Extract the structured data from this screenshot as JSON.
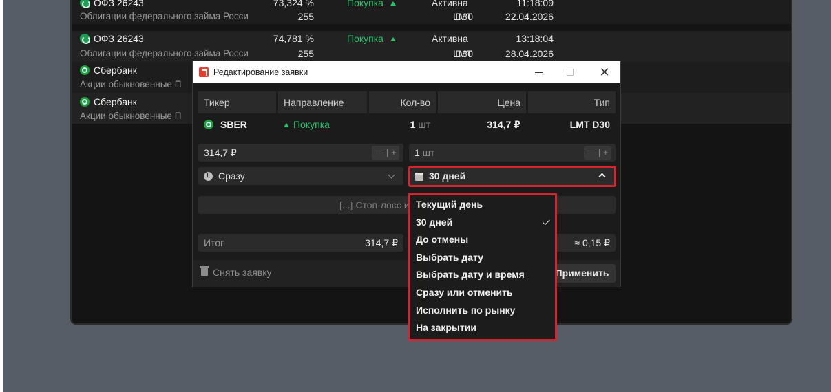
{
  "background_rows": [
    {
      "name": "ОФЗ 26243",
      "subtitle": "Облигации федерального займа Росси",
      "price": "73,324 %",
      "qty": "255",
      "direction": "Покупка",
      "type": "LMT",
      "status": "Активна",
      "duration": "D30",
      "time": "11:18:09",
      "date": "22.04.2026",
      "icon": "ofz-icon"
    },
    {
      "name": "ОФЗ 26243",
      "subtitle": "Облигации федерального займа Росси",
      "price": "74,781 %",
      "qty": "255",
      "direction": "Покупка",
      "type": "LMT",
      "status": "Активна",
      "duration": "D30",
      "time": "13:18:04",
      "date": "28.04.2026",
      "icon": "ofz-icon"
    },
    {
      "name": "Сбербанк",
      "subtitle": "Акции обыкновенные П",
      "icon": "sber-icon"
    },
    {
      "name": "Сбербанк",
      "subtitle": "Акции обыкновенные П",
      "icon": "sber-icon"
    }
  ],
  "dialog": {
    "title": "Редактирование заявки",
    "columns": [
      "Тикер",
      "Направление",
      "Кол-во",
      "Цена",
      "Тип"
    ],
    "order": {
      "ticker": "SBER",
      "direction": "Покупка",
      "qty": "1",
      "qty_unit": "шт",
      "price": "314,7 ₽",
      "type": "LMT D30"
    },
    "price_field": "314,7 ₽",
    "qty_field_value": "1",
    "qty_field_unit": "шт",
    "stepper": "— | +",
    "execution_select": "Сразу",
    "duration_select": "30 дней",
    "stop_loss_placeholder": "[...] Стоп-лосс и",
    "total_label": "Итог",
    "total_value": "314,7 ₽",
    "commission_value": "≈ 0,15 ₽",
    "cancel_button": "Снять заявку",
    "apply_button": "Применить"
  },
  "duration_menu": {
    "selected": "30 дней",
    "items": [
      "Текущий день",
      "30 дней",
      "До отмены",
      "Выбрать дату",
      "Выбрать дату и время",
      "Сразу или отменить",
      "Исполнить по рынку",
      "На закрытии"
    ]
  },
  "colors": {
    "accent_red": "#d7252f",
    "buy_green": "#27c26b",
    "desktop_gray": "#575d66"
  }
}
